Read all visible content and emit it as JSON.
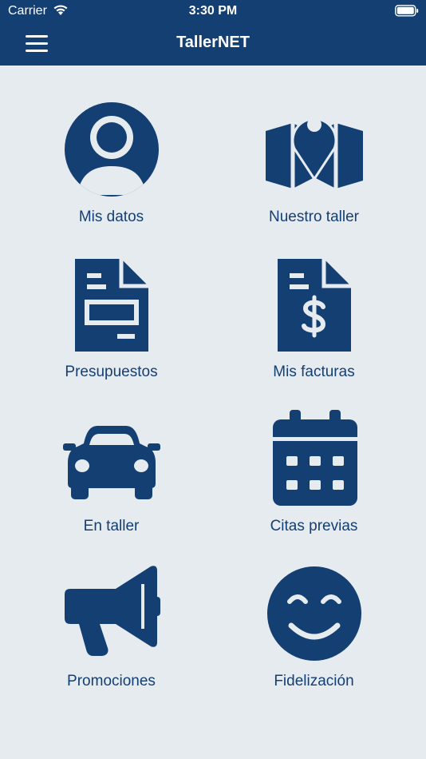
{
  "status": {
    "carrier": "Carrier",
    "time": "3:30 PM"
  },
  "navbar": {
    "title": "TallerNET"
  },
  "tiles": [
    {
      "label": "Mis datos",
      "icon": "user-icon"
    },
    {
      "label": "Nuestro taller",
      "icon": "map-marker-icon"
    },
    {
      "label": "Presupuestos",
      "icon": "document-icon"
    },
    {
      "label": "Mis facturas",
      "icon": "invoice-dollar-icon"
    },
    {
      "label": "En taller",
      "icon": "car-icon"
    },
    {
      "label": "Citas previas",
      "icon": "calendar-icon"
    },
    {
      "label": "Promociones",
      "icon": "megaphone-icon"
    },
    {
      "label": "Fidelización",
      "icon": "smile-icon"
    }
  ],
  "colors": {
    "primary": "#143f73",
    "background": "#e6ebf0"
  }
}
